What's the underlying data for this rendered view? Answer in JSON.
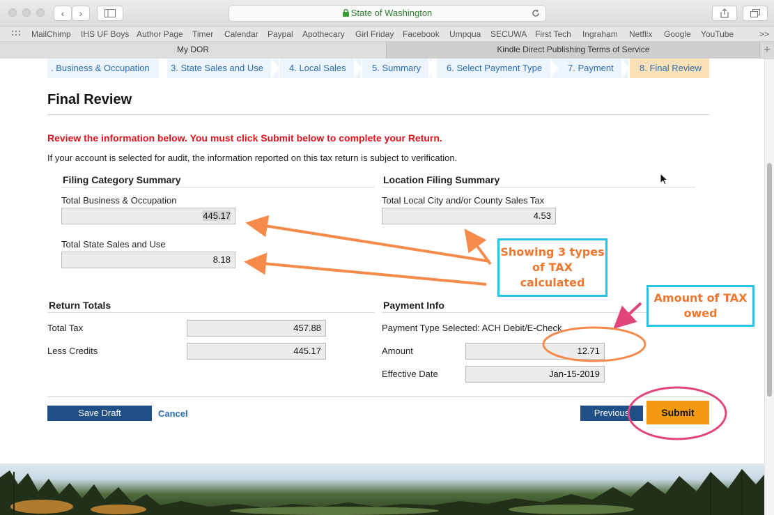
{
  "browser": {
    "url_text": "State of Washington",
    "bookmarks": [
      "MailChimp",
      "IHS UF Boys",
      "Author Page",
      "Timer",
      "Calendar",
      "Paypal",
      "Apothecary",
      "Girl Friday",
      "Facebook",
      "Umpqua",
      "SECUWA",
      "First Tech",
      "Ingraham",
      "Netflix",
      "Google",
      "YouTube"
    ],
    "more_glyph": ">>",
    "tabs": [
      "My DOR",
      "Kindle Direct Publishing Terms of Service"
    ],
    "new_tab_glyph": "+"
  },
  "steps": [
    ". Business & Occupation",
    "3. State Sales and Use",
    "4. Local Sales",
    "5. Summary",
    "6. Select Payment Type",
    "7. Payment",
    "8. Final Review"
  ],
  "page": {
    "title": "Final Review",
    "warning": "Review the information below. You must click Submit below to complete your Return.",
    "audit_note": "If your account is selected for audit, the information reported on this tax return is subject to verification."
  },
  "filing_category": {
    "heading": "Filing Category Summary",
    "bo_label": "Total Business & Occupation",
    "bo_value": "445.17",
    "ssu_label": "Total State Sales and Use",
    "ssu_value": "8.18"
  },
  "location_filing": {
    "heading": "Location Filing Summary",
    "local_label": "Total Local City and/or County Sales Tax",
    "local_value": "4.53"
  },
  "return_totals": {
    "heading": "Return Totals",
    "total_tax_label": "Total Tax",
    "total_tax_value": "457.88",
    "credits_label": "Less Credits",
    "credits_value": "445.17"
  },
  "payment_info": {
    "heading": "Payment Info",
    "type_label": "Payment Type Selected: ACH Debit/E-Check",
    "amount_label": "Amount",
    "amount_value": "12.71",
    "date_label": "Effective Date",
    "date_value": "Jan-15-2019"
  },
  "buttons": {
    "save_draft": "Save Draft",
    "cancel": "Cancel",
    "previous": "Previous",
    "submit": "Submit"
  },
  "annotations": {
    "three_types": "Showing 3 types of TAX calculated",
    "amount_owed": "Amount of TAX owed"
  },
  "colors": {
    "annotation_arrow": "#f58a4b",
    "annotation_box_border": "#29c3e6",
    "annotation_text": "#f0772f",
    "highlight_pink": "#e0457b",
    "warning_red": "#e0141e",
    "step_blue": "#2a6db5",
    "button_navy": "#1f4f86",
    "submit_orange": "#f49a10"
  }
}
